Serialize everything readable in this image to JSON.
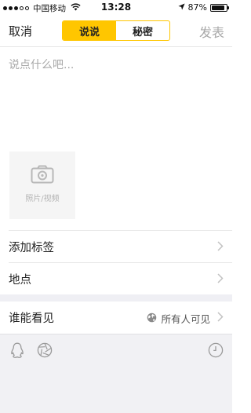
{
  "status_bar": {
    "carrier": "中国移动",
    "time": "13:28",
    "battery_percent": "87%",
    "battery_level": 0.87
  },
  "nav": {
    "cancel_label": "取消",
    "publish_label": "发表",
    "segments": [
      "说说",
      "秘密"
    ],
    "active_segment": 0
  },
  "compose": {
    "placeholder": "说点什么吧...",
    "value": "",
    "media_label": "照片/视频"
  },
  "options": {
    "add_tag_label": "添加标签",
    "location_label": "地点",
    "visibility_label": "谁能看见",
    "visibility_value": "所有人可见"
  },
  "toolbar": {
    "icons": [
      "qq-icon",
      "shutter-icon",
      "clock-icon"
    ]
  },
  "colors": {
    "accent": "#ffc600",
    "muted_text": "#a8a8a8",
    "toolbar_bg": "#f1f1f4"
  }
}
